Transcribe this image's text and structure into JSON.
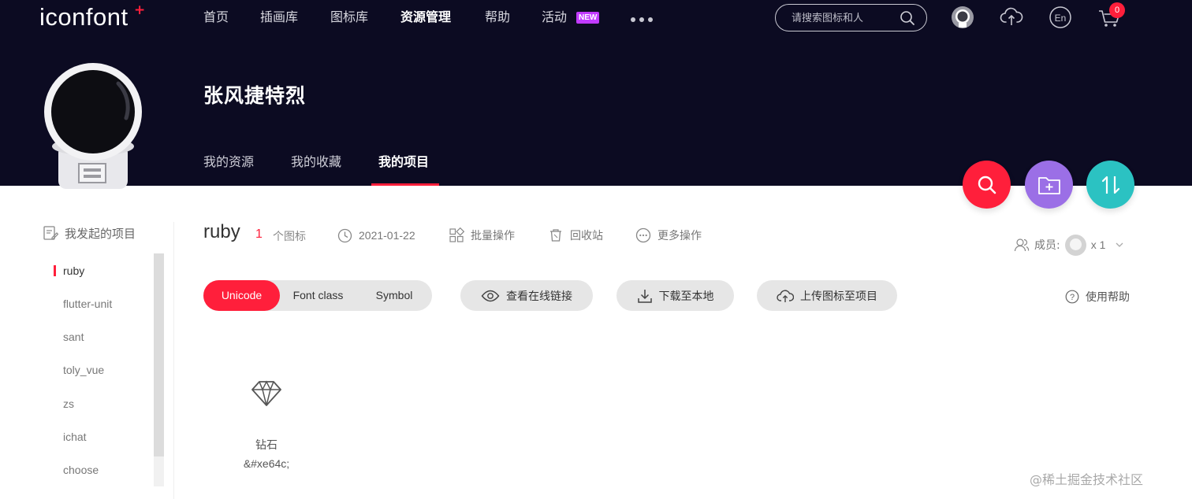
{
  "brand": {
    "logo_text": "iconfont",
    "logo_mark": "+"
  },
  "nav": {
    "items": [
      {
        "label": "首页"
      },
      {
        "label": "插画库"
      },
      {
        "label": "图标库"
      },
      {
        "label": "资源管理"
      },
      {
        "label": "帮助"
      },
      {
        "label": "活动"
      }
    ],
    "new_badge": "NEW",
    "more_icon": "ellipsis-icon"
  },
  "search": {
    "placeholder": "请搜索图标和人"
  },
  "cart": {
    "count": "0"
  },
  "user": {
    "name": "张风捷特烈"
  },
  "sub_tabs": [
    {
      "label": "我的资源"
    },
    {
      "label": "我的收藏"
    },
    {
      "label": "我的项目"
    }
  ],
  "fab_colors": {
    "search": "#ff1f3b",
    "add_folder": "#9b6fe6",
    "sort": "#2bc2c2"
  },
  "sidebar": {
    "title": "我发起的项目",
    "items": [
      {
        "label": "ruby"
      },
      {
        "label": "flutter-unit"
      },
      {
        "label": "sant"
      },
      {
        "label": "toly_vue"
      },
      {
        "label": "zs"
      },
      {
        "label": "ichat"
      },
      {
        "label": "choose"
      }
    ]
  },
  "project": {
    "name": "ruby",
    "icon_count": "1",
    "icon_count_label": "个图标",
    "date": "2021-01-22",
    "batch_label": "批量操作",
    "recycle_label": "回收站",
    "more_label": "更多操作",
    "members_label": "成员:",
    "members_count": "x 1"
  },
  "toolbar": {
    "tabs": [
      {
        "label": "Unicode"
      },
      {
        "label": "Font class"
      },
      {
        "label": "Symbol"
      }
    ],
    "view_link": "查看在线链接",
    "download": "下载至本地",
    "upload": "上传图标至项目",
    "help": "使用帮助"
  },
  "icons": [
    {
      "name": "钻石",
      "code": "&#xe64c;",
      "glyph": "diamond-icon"
    }
  ],
  "watermark": "@稀土掘金技术社区"
}
